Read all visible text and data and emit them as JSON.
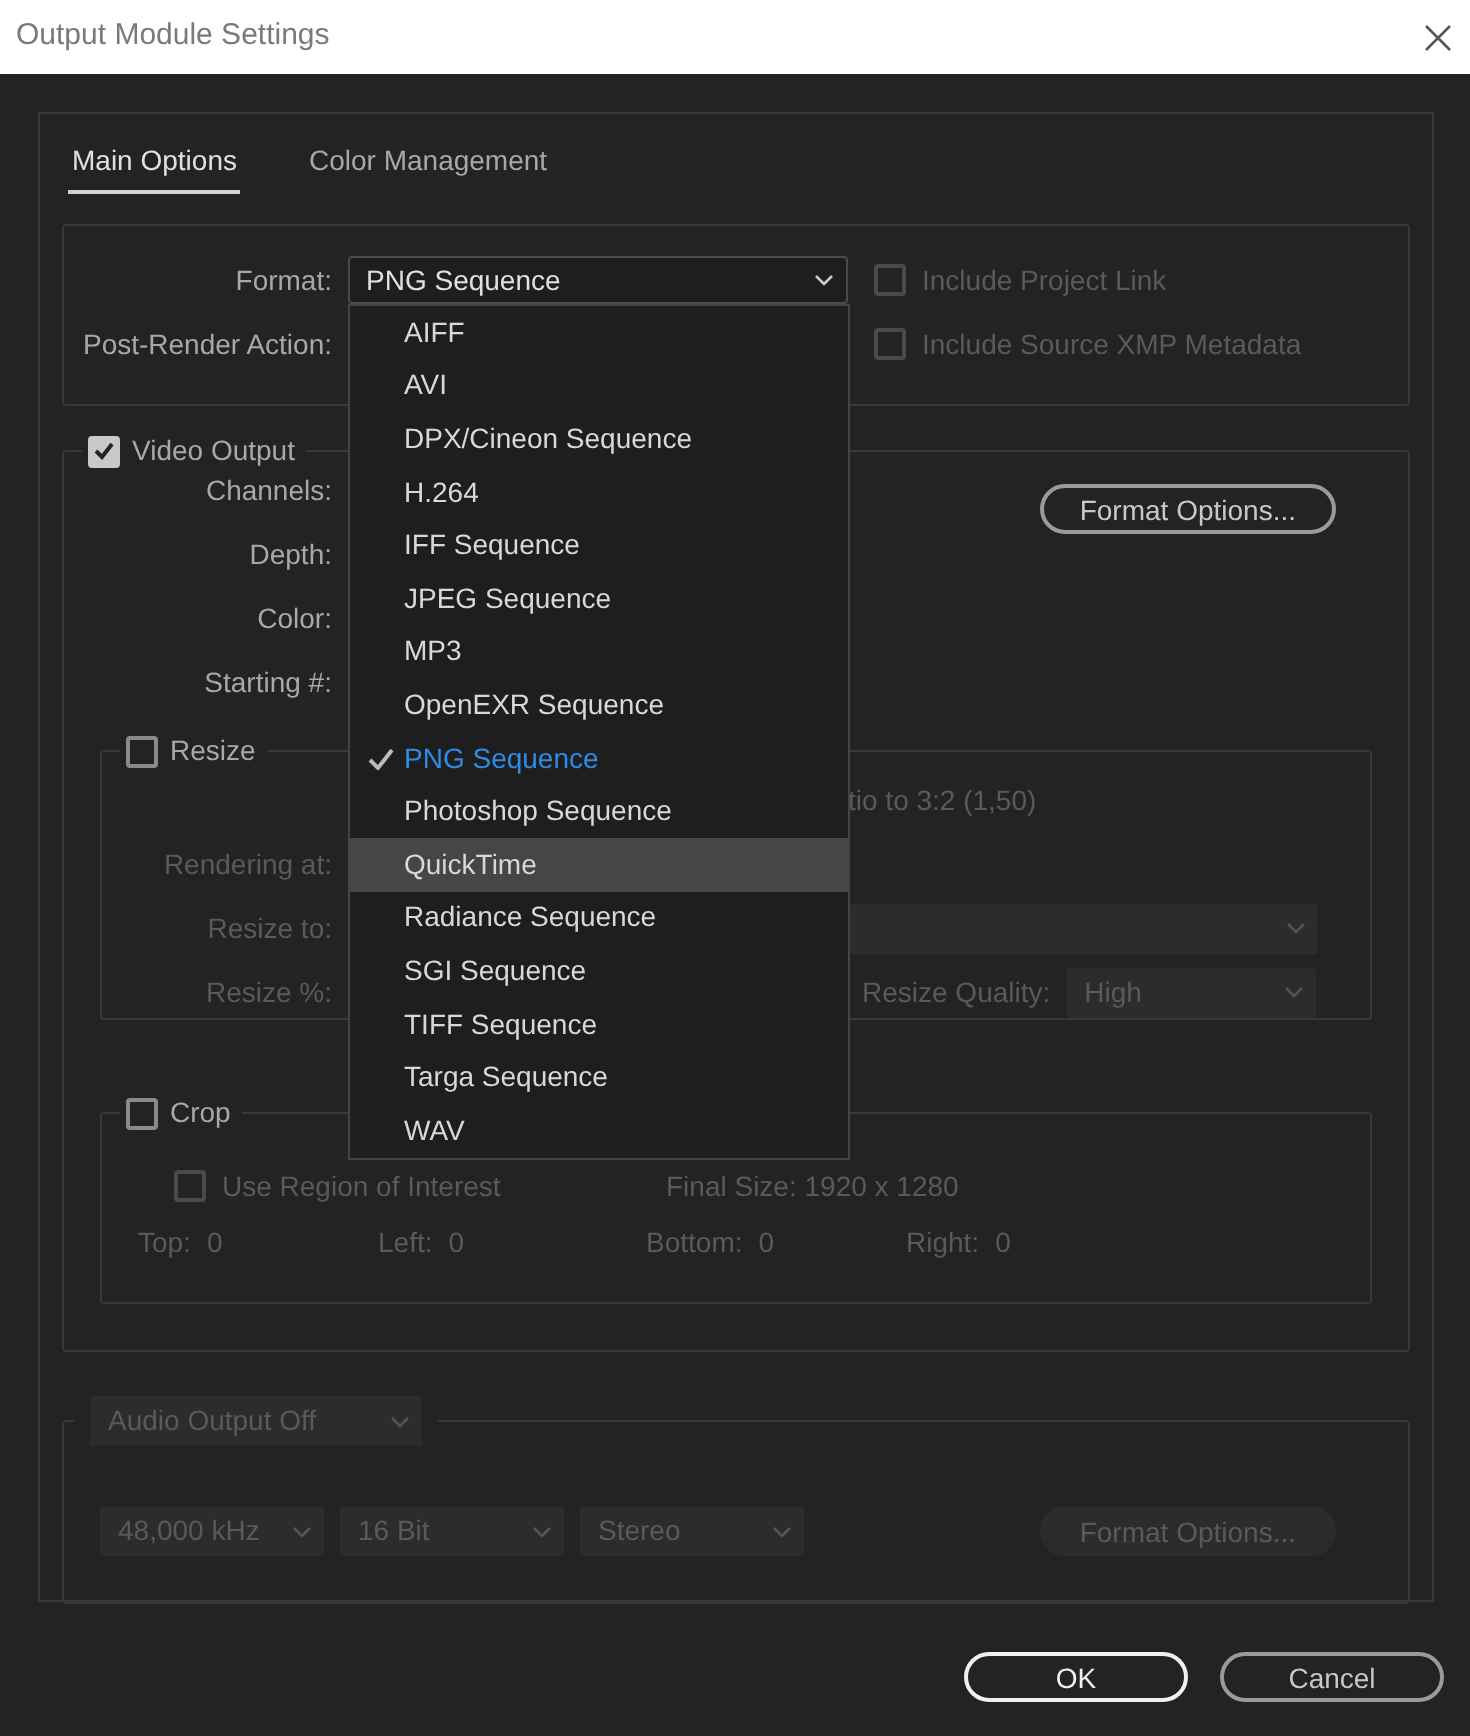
{
  "window": {
    "title": "Output Module Settings"
  },
  "tabs": [
    {
      "label": "Main Options",
      "selected": true
    },
    {
      "label": "Color Management",
      "selected": false
    }
  ],
  "format": {
    "label": "Format:",
    "value": "PNG Sequence"
  },
  "post_render": {
    "label": "Post-Render Action:"
  },
  "options": [
    {
      "label": "Include Project Link",
      "checked": false,
      "disabled": true
    },
    {
      "label": "Include Source XMP Metadata",
      "checked": false,
      "disabled": true
    }
  ],
  "format_menu": [
    {
      "label": "AIFF",
      "selected": false,
      "hovered": false
    },
    {
      "label": "AVI",
      "selected": false,
      "hovered": false
    },
    {
      "label": "DPX/Cineon Sequence",
      "selected": false,
      "hovered": false
    },
    {
      "label": "H.264",
      "selected": false,
      "hovered": false
    },
    {
      "label": "IFF Sequence",
      "selected": false,
      "hovered": false
    },
    {
      "label": "JPEG Sequence",
      "selected": false,
      "hovered": false
    },
    {
      "label": "MP3",
      "selected": false,
      "hovered": false
    },
    {
      "label": "OpenEXR Sequence",
      "selected": false,
      "hovered": false
    },
    {
      "label": "PNG Sequence",
      "selected": true,
      "hovered": false
    },
    {
      "label": "Photoshop Sequence",
      "selected": false,
      "hovered": false
    },
    {
      "label": "QuickTime",
      "selected": false,
      "hovered": true
    },
    {
      "label": "Radiance Sequence",
      "selected": false,
      "hovered": false
    },
    {
      "label": "SGI Sequence",
      "selected": false,
      "hovered": false
    },
    {
      "label": "TIFF Sequence",
      "selected": false,
      "hovered": false
    },
    {
      "label": "Targa Sequence",
      "selected": false,
      "hovered": false
    },
    {
      "label": "WAV",
      "selected": false,
      "hovered": false
    }
  ],
  "video_output": {
    "label": "Video Output",
    "checked": true,
    "rows": [
      "Channels:",
      "Depth:",
      "Color:",
      "Starting #:"
    ],
    "format_options": {
      "label": "Format Options...",
      "disabled": false
    }
  },
  "resize": {
    "label": "Resize",
    "checked": false,
    "ratio_text": "tio to 3:2 (1,50)",
    "rows": [
      "Rendering at:",
      "Resize to:",
      "Resize %:"
    ],
    "quality": {
      "label": "Resize Quality:",
      "value": "High"
    }
  },
  "crop": {
    "label": "Crop",
    "checked": false,
    "roi": {
      "label": "Use Region of Interest",
      "checked": false
    },
    "final_size": "Final Size: 1920 x 1280",
    "edges": [
      {
        "label": "Top:",
        "value": "0"
      },
      {
        "label": "Left:",
        "value": "0"
      },
      {
        "label": "Bottom:",
        "value": "0"
      },
      {
        "label": "Right:",
        "value": "0"
      }
    ]
  },
  "audio": {
    "mode": "Audio Output Off",
    "selects": [
      "48,000 kHz",
      "16 Bit",
      "Stereo"
    ],
    "format_options": {
      "label": "Format Options...",
      "disabled": true
    }
  },
  "buttons": [
    {
      "label": "OK",
      "kind": "default"
    },
    {
      "label": "Cancel",
      "kind": "normal"
    }
  ]
}
